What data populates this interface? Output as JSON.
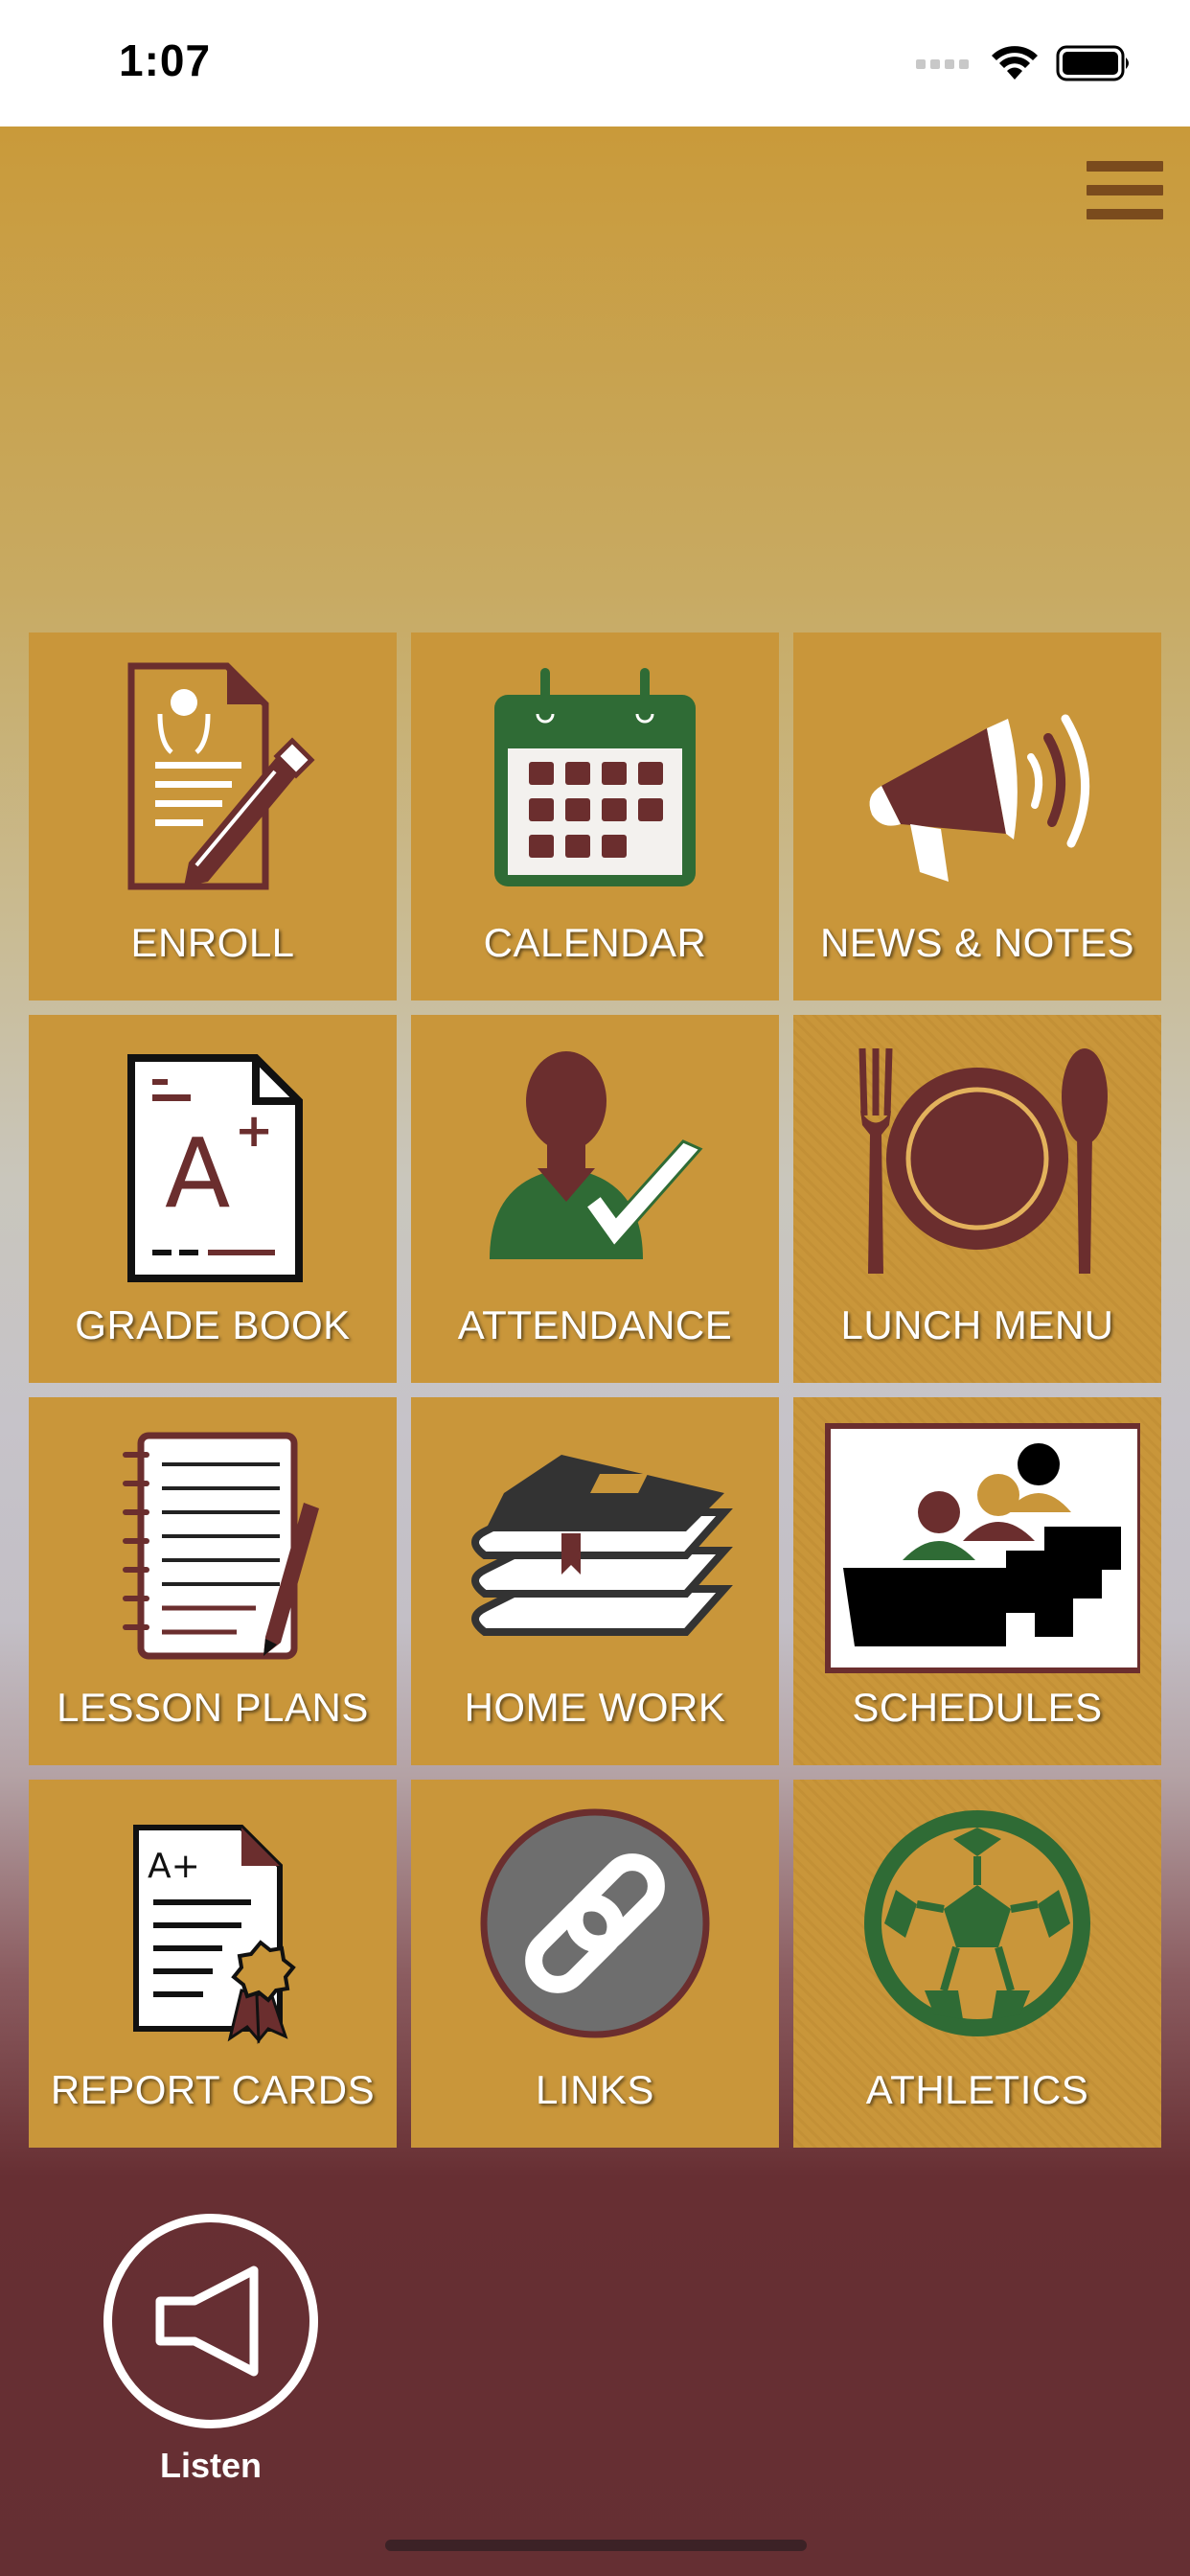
{
  "status_bar": {
    "time": "1:07"
  },
  "header": {
    "menu_icon": "hamburger-menu-icon"
  },
  "tiles": [
    {
      "label": "ENROLL",
      "icon": "enroll-form-pencil-icon"
    },
    {
      "label": "CALENDAR",
      "icon": "calendar-icon"
    },
    {
      "label": "NEWS  & NOTES",
      "icon": "megaphone-icon"
    },
    {
      "label": "GRADE BOOK",
      "icon": "grade-paper-icon"
    },
    {
      "label": "ATTENDANCE",
      "icon": "person-checkmark-icon"
    },
    {
      "label": "LUNCH MENU",
      "icon": "plate-fork-spoon-icon"
    },
    {
      "label": "LESSON PLANS",
      "icon": "notebook-pencil-icon"
    },
    {
      "label": "HOME WORK",
      "icon": "book-stack-icon"
    },
    {
      "label": "SCHEDULES",
      "icon": "classroom-icon"
    },
    {
      "label": "REPORT CARDS",
      "icon": "report-card-ribbon-icon"
    },
    {
      "label": "LINKS",
      "icon": "chain-link-icon"
    },
    {
      "label": "ATHLETICS",
      "icon": "soccer-ball-icon"
    }
  ],
  "listen": {
    "label": "Listen",
    "icon": "speaker-icon"
  },
  "colors": {
    "gold": "#c9963a",
    "maroon": "#652f33",
    "green": "#2f6b35",
    "brown": "#6a2f2f"
  }
}
